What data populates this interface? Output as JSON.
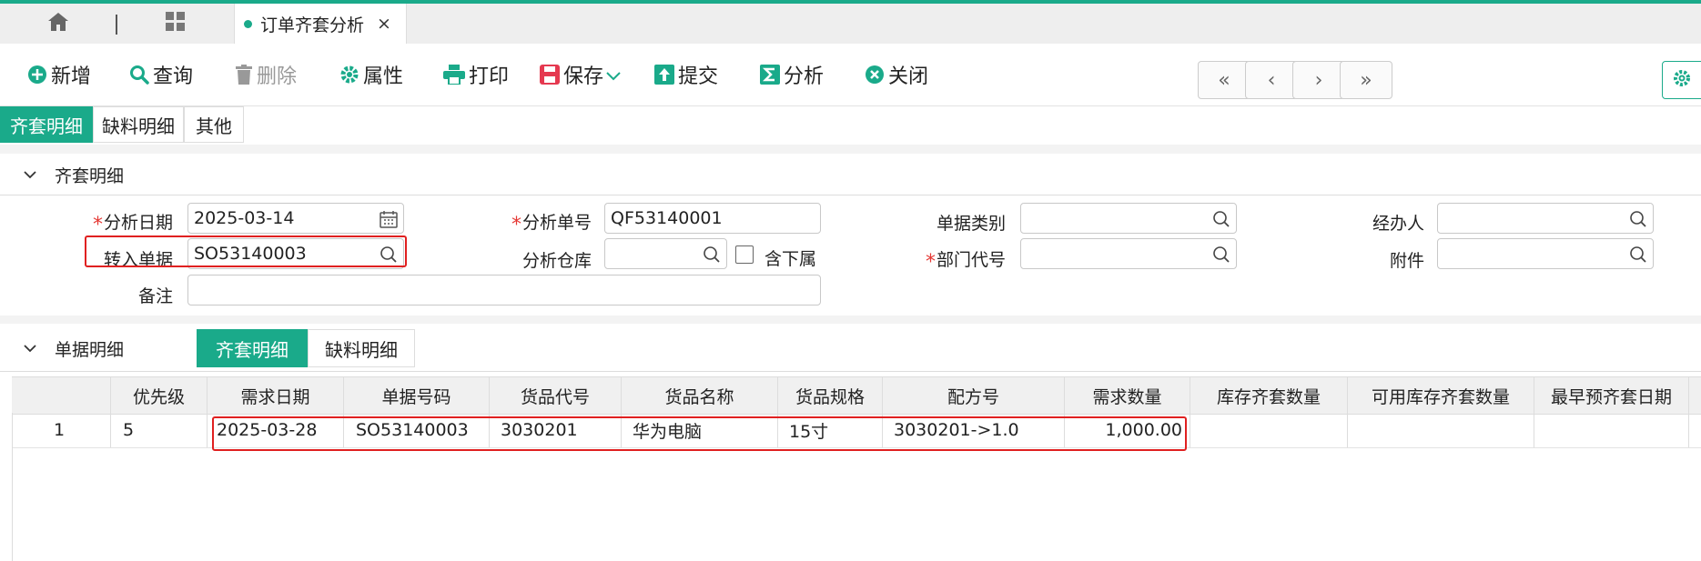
{
  "colors": {
    "accent": "#1aaa8a",
    "required": "#e53935",
    "highlight": "#e02020"
  },
  "tabs": {
    "home_icon": "home-icon",
    "grid_icon": "grid-icon",
    "active_label": "订单齐套分析",
    "close_label": "×"
  },
  "toolbar": {
    "buttons": [
      {
        "label": "新增",
        "icon": "plus-circle-icon"
      },
      {
        "label": "查询",
        "icon": "search-icon"
      },
      {
        "label": "删除",
        "icon": "trash-icon"
      },
      {
        "label": "属性",
        "icon": "gear-icon"
      },
      {
        "label": "打印",
        "icon": "printer-icon"
      },
      {
        "label": "保存",
        "icon": "save-icon"
      },
      {
        "label": "提交",
        "icon": "upload-icon"
      },
      {
        "label": "分析",
        "icon": "sigma-icon"
      },
      {
        "label": "关闭",
        "icon": "close-circle-icon"
      }
    ],
    "nav": {
      "first": "«",
      "prev": "‹",
      "next": "›",
      "last": "»"
    }
  },
  "subtabs": [
    "齐套明细",
    "缺料明细",
    "其他"
  ],
  "section1": {
    "title": "齐套明细"
  },
  "form": {
    "analysis_date_label": "分析日期",
    "analysis_date_value": "2025-03-14",
    "transfer_doc_label": "转入单据",
    "transfer_doc_value": "SO53140003",
    "remark_label": "备注",
    "analysis_no_label": "分析单号",
    "analysis_no_value": "QF53140001",
    "analysis_wh_label": "分析仓库",
    "include_sub_label": "含下属",
    "doc_type_label": "单据类别",
    "dept_code_label": "部门代号",
    "handler_label": "经办人",
    "attachment_label": "附件"
  },
  "section2": {
    "title": "单据明细",
    "tabs": [
      "齐套明细",
      "缺料明细"
    ]
  },
  "table": {
    "headers": [
      "优先级",
      "需求日期",
      "单据号码",
      "货品代号",
      "货品名称",
      "货品规格",
      "配方号",
      "需求数量",
      "库存齐套数量",
      "可用库存齐套数量",
      "最早预齐套日期"
    ],
    "rows": [
      {
        "index": "1",
        "cells": [
          "5",
          "2025-03-28",
          "SO53140003",
          "3030201",
          "华为电脑",
          "15寸",
          "3030201->1.0",
          "1,000.00",
          "",
          "",
          ""
        ]
      }
    ]
  }
}
